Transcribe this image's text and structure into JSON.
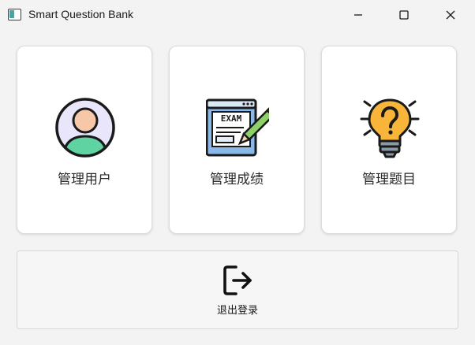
{
  "window": {
    "title": "Smart Question Bank",
    "app_icon": "window-app-icon",
    "controls": {
      "minimize": "minimize-icon",
      "maximize": "maximize-icon",
      "close": "close-icon"
    }
  },
  "cards": {
    "users": {
      "label": "管理用户",
      "icon": "user-avatar-icon"
    },
    "scores": {
      "label": "管理成绩",
      "icon": "exam-pencil-icon",
      "icon_text": "EXAM"
    },
    "questions": {
      "label": "管理题目",
      "icon": "question-lightbulb-icon"
    }
  },
  "logout": {
    "label": "退出登录",
    "icon": "logout-icon"
  },
  "colors": {
    "background": "#f3f3f3",
    "card": "#ffffff",
    "avatar_face": "#f7c7aa",
    "avatar_body": "#5fd3a2",
    "avatar_bg": "#e9e6fb",
    "exam_paper": "#8ab8e8",
    "bulb": "#f9b53a",
    "bulb_base": "#8a98a8"
  }
}
